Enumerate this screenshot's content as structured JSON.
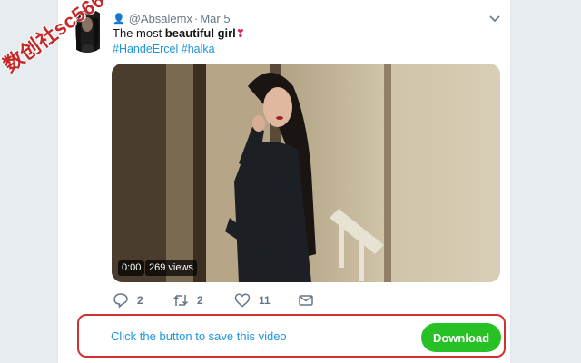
{
  "tweet": {
    "handle": "@Absalemx",
    "separator": "·",
    "date": "Mar 5",
    "text_prefix": "The most ",
    "text_bold": "beautiful girl",
    "text_emoji": "❣",
    "hashtags": [
      "#HandeErcel",
      "#halka"
    ]
  },
  "video": {
    "time": "0:00",
    "views": "269 views"
  },
  "actions": {
    "reply_count": "2",
    "retweet_count": "2",
    "like_count": "11"
  },
  "promo": {
    "text": "Click the button to save this video",
    "button_label": "Download"
  },
  "watermark": "数创社sc566",
  "colors": {
    "link": "#1b95e0",
    "download_button": "#27c125",
    "promo_border": "#d32f2f",
    "heart": "#e0245e"
  },
  "icons": [
    "chevron-down-icon",
    "reply-icon",
    "retweet-icon",
    "like-icon",
    "dm-icon"
  ]
}
